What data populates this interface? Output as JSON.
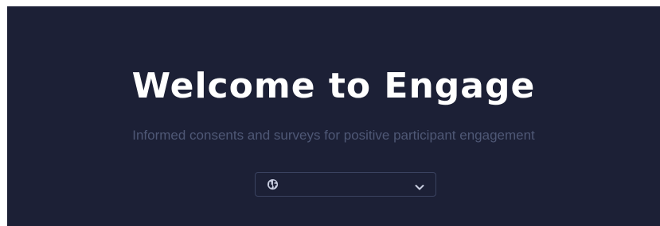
{
  "hero": {
    "title": "Welcome to Engage",
    "subtitle": "Informed consents and surveys for positive participant engagement"
  },
  "language_select": {
    "selected_value": "",
    "icon": "globe-icon",
    "toggle_icon": "chevron-down-icon"
  },
  "colors": {
    "background": "#1c2036",
    "title": "#ffffff",
    "subtitle": "#4f5876",
    "select_border": "#3a4260",
    "icon": "#c8cde0"
  }
}
